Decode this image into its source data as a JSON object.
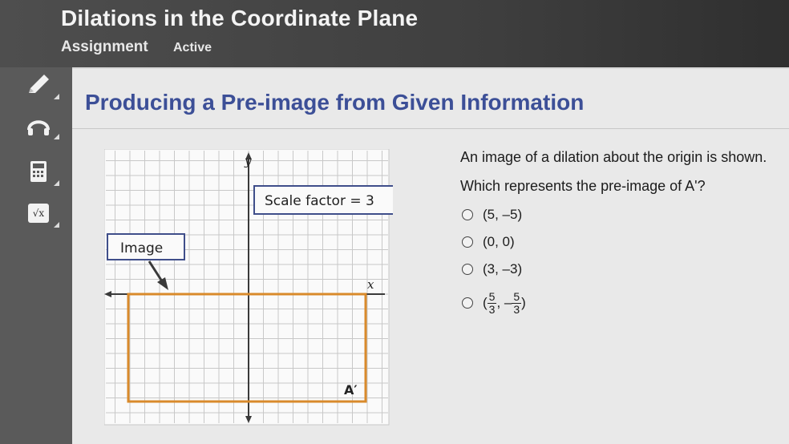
{
  "header": {
    "title": "Dilations in the Coordinate Plane",
    "assignment_label": "Assignment",
    "status_label": "Active"
  },
  "sidebar": {
    "tools": [
      {
        "icon": "pencil-icon"
      },
      {
        "icon": "headphones-icon"
      },
      {
        "icon": "calculator-icon"
      },
      {
        "icon": "formula-sqrt-icon",
        "glyph": "√x"
      }
    ]
  },
  "section": {
    "heading": "Producing a Pre-image from Given Information"
  },
  "graph": {
    "y_label": "y",
    "x_label": "x",
    "scale_callout": "Scale factor = 3",
    "image_callout": "Image",
    "point_label": "A′",
    "colors": {
      "grid": "#c8c8c8",
      "rectangle": "#d98a2b",
      "axis": "#3a3a3a",
      "callout_border": "#3f4e8a"
    }
  },
  "question": {
    "prompt": "An image of a dilation about the origin is shown.",
    "text": "Which represents the pre-image of A'?",
    "options": [
      {
        "label": "(5, –5)"
      },
      {
        "label": "(0, 0)"
      },
      {
        "label": "(3, –3)"
      },
      {
        "open": "(",
        "num1": "5",
        "den1": "3",
        "sep": ", –",
        "num2": "5",
        "den2": "3",
        "close": ")"
      }
    ]
  }
}
